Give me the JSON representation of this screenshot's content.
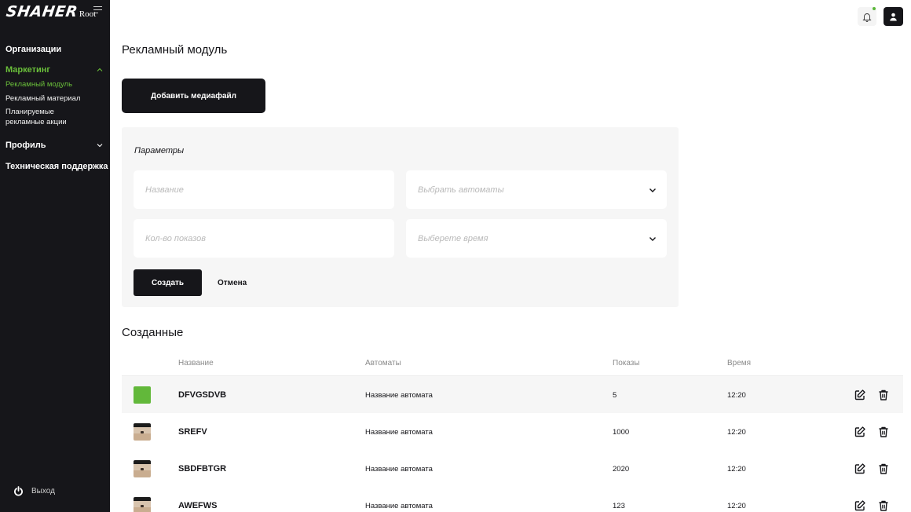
{
  "app": {
    "logo_text": "SHAHER",
    "logo_sub": "Root"
  },
  "sidebar": {
    "sections": [
      {
        "label": "Организации"
      },
      {
        "label": "Маркетинг",
        "active": true,
        "expanded": true,
        "items": [
          {
            "label": "Рекламный модуль",
            "active": true
          },
          {
            "label": "Рекламный материал"
          },
          {
            "label": "Планируемые рекламные акции"
          }
        ]
      },
      {
        "label": "Профиль",
        "expanded": false
      },
      {
        "label": "Техническая поддержка"
      }
    ],
    "logout_label": "Выход"
  },
  "header": {
    "bell_icon": "bell-icon",
    "user_icon": "user-icon"
  },
  "main": {
    "title": "Рекламный модуль",
    "add_button": "Добавить медиафайл",
    "form": {
      "title": "Параметры",
      "name_placeholder": "Название",
      "machines_placeholder": "Выбрать автоматы",
      "count_placeholder": "Кол-во показов",
      "time_placeholder": "Выберете время",
      "create_button": "Создать",
      "cancel_button": "Отмена"
    },
    "created": {
      "title": "Созданные",
      "columns": [
        "Название",
        "Автоматы",
        "Показы",
        "Время"
      ],
      "rows": [
        {
          "name": "DFVGSDVB",
          "machine": "Название автомата",
          "shows": "5",
          "time": "12:20",
          "thumb": "green",
          "highlight": true
        },
        {
          "name": "SREFV",
          "machine": "Название автомата",
          "shows": "1000",
          "time": "12:20",
          "thumb": "photo"
        },
        {
          "name": "SBDFBTGR",
          "machine": "Название автомата",
          "shows": "2020",
          "time": "12:20",
          "thumb": "photo"
        },
        {
          "name": "AWEFWS",
          "machine": "Название автомата",
          "shows": "123",
          "time": "12:20",
          "thumb": "photo"
        }
      ]
    }
  },
  "colors": {
    "accent": "#6abf3a",
    "sidebar_bg": "#16161a",
    "card_bg": "#f6f6f6"
  }
}
